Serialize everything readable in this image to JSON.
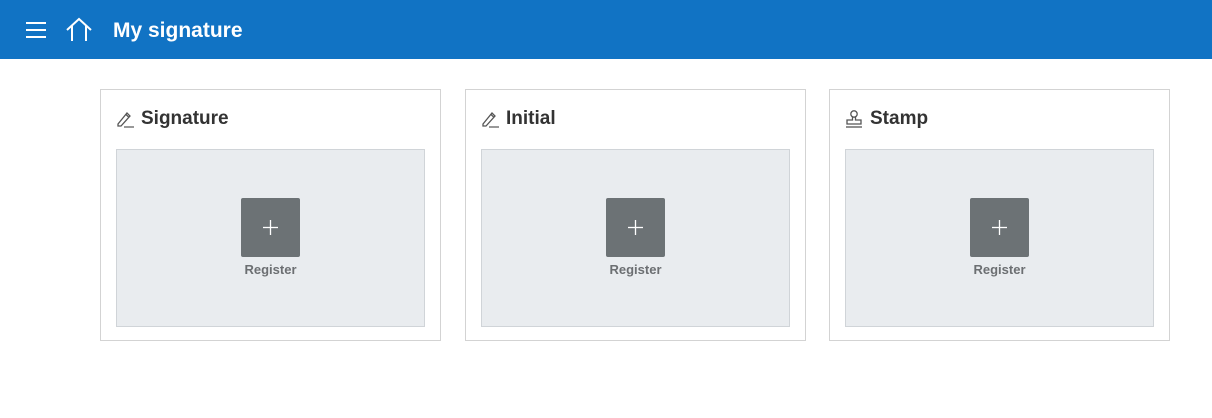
{
  "header": {
    "title": "My signature",
    "menu_icon": "hamburger-menu-icon",
    "home_icon": "home-icon",
    "background": "#1173c4"
  },
  "cards": [
    {
      "title": "Signature",
      "icon": "pen-icon",
      "action_label": "Register"
    },
    {
      "title": "Initial",
      "icon": "pen-icon",
      "action_label": "Register"
    },
    {
      "title": "Stamp",
      "icon": "stamp-icon",
      "action_label": "Register"
    }
  ],
  "colors": {
    "drop_area": "#e9ecef",
    "add_button": "#6c7275"
  }
}
